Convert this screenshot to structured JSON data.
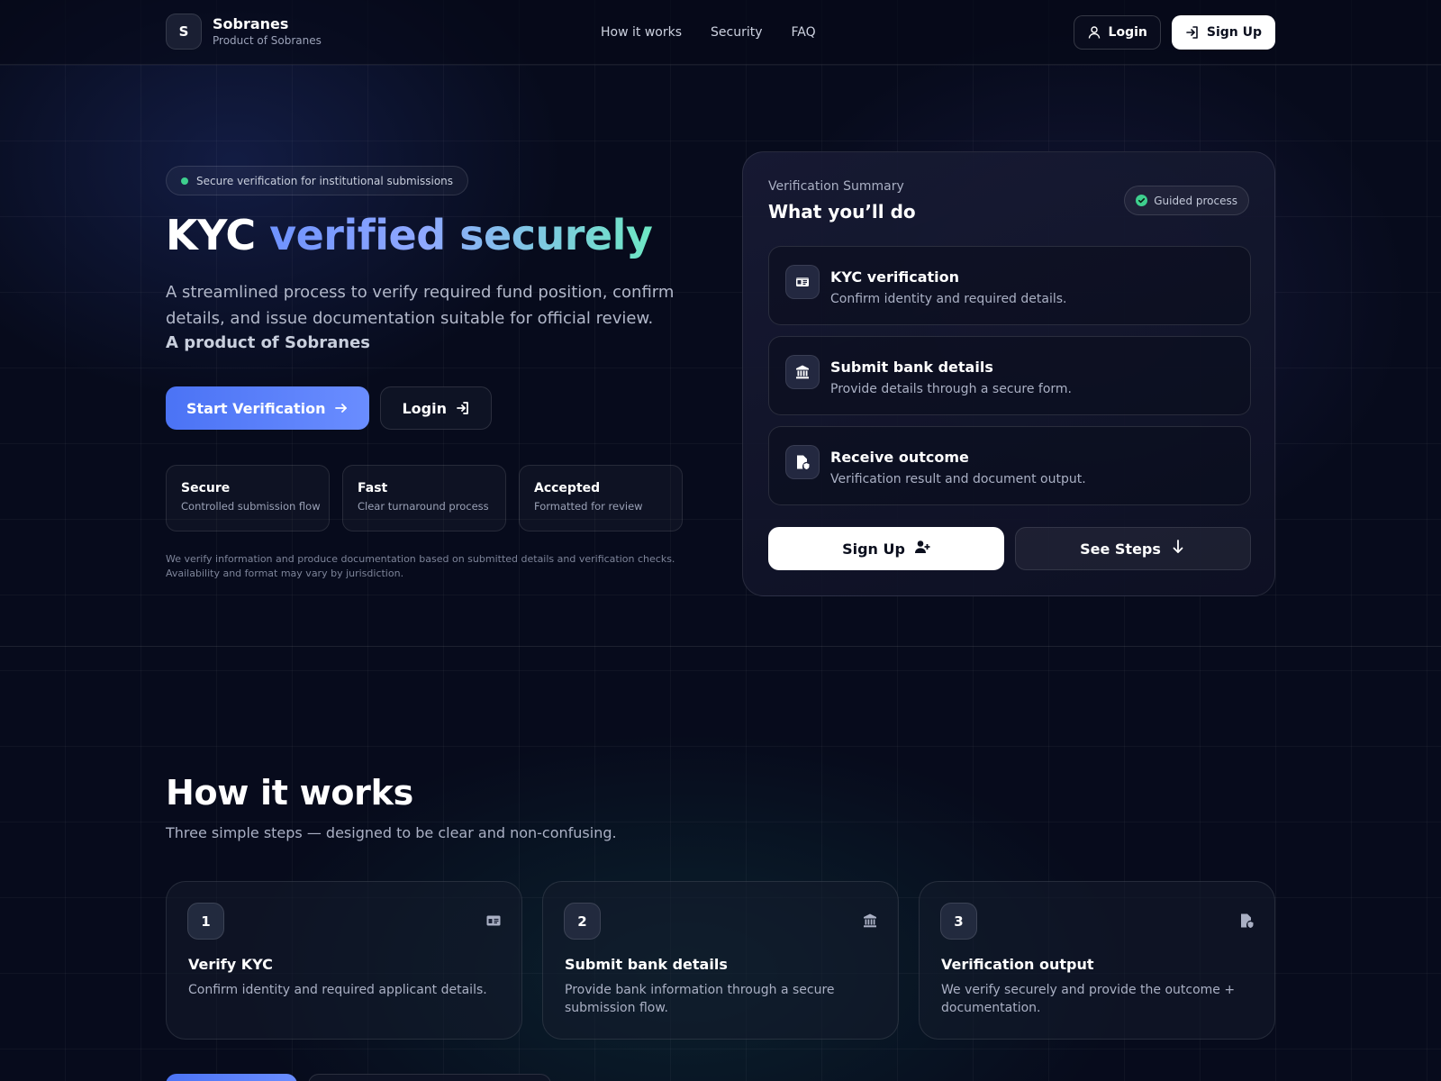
{
  "header": {
    "brand_initial": "S",
    "brand_name": "Sobranes",
    "brand_sub": "Product of Sobranes",
    "nav": [
      "How it works",
      "Security",
      "FAQ"
    ],
    "login_label": "Login",
    "signup_label": "Sign Up"
  },
  "hero": {
    "badge": "Secure verification for institutional submissions",
    "title_plain": "KYC ",
    "title_gradient": "verified securely",
    "description": "A streamlined process to verify required fund position, confirm details, and issue documentation suitable for official review.",
    "product_line": "A product of Sobranes",
    "primary_button": "Start Verification",
    "secondary_button": "Login",
    "features": [
      {
        "title": "Secure",
        "desc": "Controlled submission flow"
      },
      {
        "title": "Fast",
        "desc": "Clear turnaround process"
      },
      {
        "title": "Accepted",
        "desc": "Formatted for review"
      }
    ],
    "disclaimer": "We verify information and produce documentation based on submitted details and verification checks. Availability and format may vary by jurisdiction."
  },
  "summary": {
    "label": "Verification Summary",
    "title": "What you’ll do",
    "badge": "Guided process",
    "steps": [
      {
        "title": "KYC verification",
        "desc": "Confirm identity and required details.",
        "icon": "id-card-icon"
      },
      {
        "title": "Submit bank details",
        "desc": "Provide details through a secure form.",
        "icon": "bank-icon"
      },
      {
        "title": "Receive outcome",
        "desc": "Verification result and document output.",
        "icon": "file-shield-icon"
      }
    ],
    "signup_button": "Sign Up",
    "steps_button": "See Steps"
  },
  "how_it_works": {
    "title": "How it works",
    "subtitle": "Three simple steps — designed to be clear and non-confusing.",
    "cards": [
      {
        "num": "1",
        "title": "Verify KYC",
        "desc": "Confirm identity and required applicant details.",
        "icon": "id-card-icon"
      },
      {
        "num": "2",
        "title": "Submit bank details",
        "desc": "Provide bank information through a secure submission flow.",
        "icon": "bank-icon"
      },
      {
        "num": "3",
        "title": "Verification output",
        "desc": "We verify securely and provide the outcome + documentation.",
        "icon": "file-shield-icon"
      }
    ]
  },
  "colors": {
    "accent": "#4b73f5",
    "success": "#3ecf8e",
    "background": "#070b1c"
  }
}
